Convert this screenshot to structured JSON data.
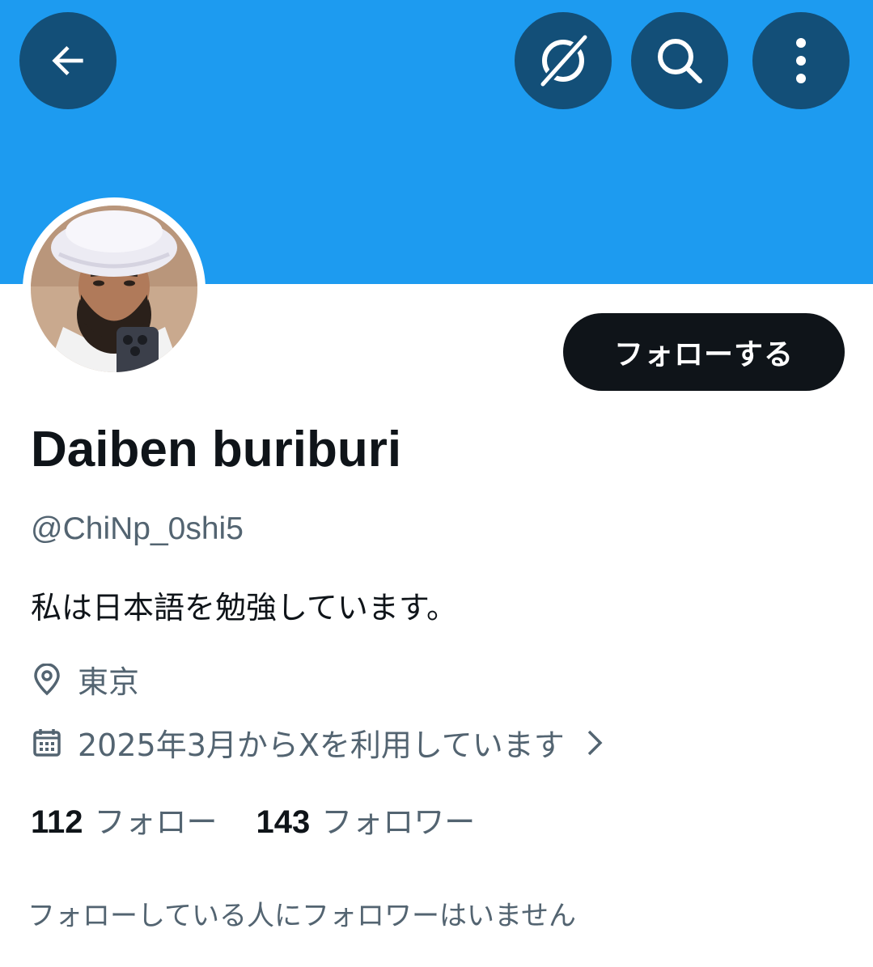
{
  "colors": {
    "banner": "#1d9bf0",
    "header_button_bg": "#134f78",
    "primary_text": "#0f1419",
    "secondary_text": "#536471",
    "follow_button_bg": "#0f1419",
    "follow_button_text": "#ffffff"
  },
  "header": {
    "buttons": [
      {
        "icon": "back-arrow-icon"
      },
      {
        "icon": "grok-icon"
      },
      {
        "icon": "search-icon"
      },
      {
        "icon": "more-vertical-icon"
      }
    ]
  },
  "profile": {
    "avatar_icon": "avatar",
    "follow_label": "フォローする",
    "display_name": "Daiben buriburi",
    "handle": "@ChiNp_0shi5",
    "bio": "私は日本語を勉強しています。",
    "location_icon": "location-pin-icon",
    "location": "東京",
    "joined_icon": "calendar-icon",
    "joined": "2025年3月からXを利用しています",
    "joined_chevron_icon": "chevron-right-icon"
  },
  "stats": {
    "following_count": "112",
    "following_label": "フォロー",
    "followers_count": "143",
    "followers_label": "フォロワー"
  },
  "mutual_note": "フォローしている人にフォロワーはいません"
}
